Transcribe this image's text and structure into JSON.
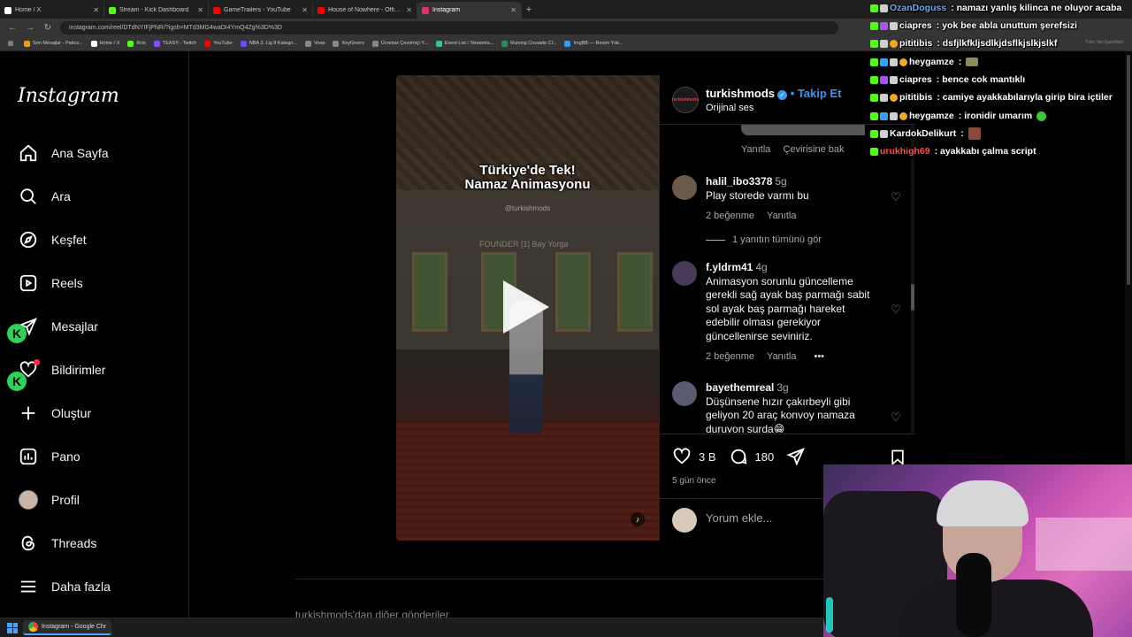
{
  "browser": {
    "tabs": [
      {
        "label": "Home / X",
        "favicon": "X",
        "color": "#ffffff"
      },
      {
        "label": "Stream - Kick Dashboard",
        "favicon": "K",
        "color": "#53fc18"
      },
      {
        "label": "GameTrailers - YouTube",
        "favicon": "▶",
        "color": "#ff0000"
      },
      {
        "label": "House of Nowhere - Official R",
        "favicon": "▶",
        "color": "#ff0000"
      },
      {
        "label": "Instagram",
        "favicon": "◎",
        "color": "#e1306c"
      }
    ],
    "new_tab": "+",
    "url": "instagram.com/reel/DTdNYIFjPNR/?igsh=MTd3MG4waDI4YmQ4Zg%3D%3D",
    "bookmarks": [
      {
        "label": "Son Mesajlar - Patics...",
        "color": "#f39c12"
      },
      {
        "label": "Home / X",
        "color": "#ffffff"
      },
      {
        "label": "Kick",
        "color": "#53fc18"
      },
      {
        "label": "TEASY - Twitch",
        "color": "#9146ff"
      },
      {
        "label": "YouTube",
        "color": "#ff0000"
      },
      {
        "label": "NBA 3. Lig 8 Katego...",
        "color": "#6a4cff"
      },
      {
        "label": "Voep",
        "color": "#888888"
      },
      {
        "label": "KeyGivers",
        "color": "#888888"
      },
      {
        "label": "Ücretsiz Çevrimiçi Y...",
        "color": "#888888"
      },
      {
        "label": "Event List / Streamla...",
        "color": "#31c3a2"
      },
      {
        "label": "Ruining Crusade Cl...",
        "color": "#2e8b57"
      },
      {
        "label": "ImgBB — Resim Yük...",
        "color": "#2a9df4"
      }
    ],
    "bookmarks_right": "Tüm Yer İşaretleri"
  },
  "instagram": {
    "logo": "Instagram",
    "nav": [
      {
        "label": "Ana Sayfa",
        "icon": "home-icon"
      },
      {
        "label": "Ara",
        "icon": "search-icon"
      },
      {
        "label": "Keşfet",
        "icon": "explore-icon"
      },
      {
        "label": "Reels",
        "icon": "reels-icon"
      },
      {
        "label": "Mesajlar",
        "icon": "messages-icon"
      },
      {
        "label": "Bildirimler",
        "icon": "notifications-icon"
      },
      {
        "label": "Oluştur",
        "icon": "create-icon"
      },
      {
        "label": "Pano",
        "icon": "dashboard-icon"
      },
      {
        "label": "Profil",
        "icon": "profile-icon"
      },
      {
        "label": "Threads",
        "icon": "threads-icon"
      },
      {
        "label": "Daha fazla",
        "icon": "menu-icon"
      }
    ],
    "video": {
      "title_line1": "Türkiye'de Tek!",
      "title_line2": "Namaz Animasyonu",
      "handle": "@turkishmods",
      "founder_tag": "FOUNDER [1] Bay Yorga"
    },
    "post": {
      "username": "turkishmods",
      "separator": "•",
      "follow": "Takip Et",
      "audio": "Orijinal ses",
      "avatar_text": "turkishmods",
      "prev_reply": "Yanıtla",
      "prev_translate": "Çevirisine bak",
      "comments": [
        {
          "user": "halil_ibo3378",
          "time": "5g",
          "text": "Play storede varmı bu",
          "likes": "2 beğenme",
          "reply": "Yanıtla",
          "avatar_color": "#6b5a4a"
        },
        {
          "user": "f.yldrm41",
          "time": "4g",
          "text": "Animasyon sorunlu güncelleme gerekli sağ ayak baş parmağı sabit sol ayak baş parmağı hareket edebilir olması gerekiyor güncellenirse seviniriz.",
          "likes": "2 beğenme",
          "reply": "Yanıtla",
          "more": "•••",
          "avatar_color": "#4a3a5a"
        },
        {
          "user": "bayethemreal",
          "time": "3g",
          "text": "Düşünsene hızır çakırbeyli gibi geliyon 20 araç konvoy namaza duruyon surda😁",
          "avatar_color": "#5a5a70"
        }
      ],
      "view_replies": "1 yanıtın tümünü gör",
      "likes": "3 B",
      "comment_count": "180",
      "posted": "5 gün önce",
      "add_comment_placeholder": "Yorum ekle..."
    },
    "bottom_text": "turkishmods'dan diğer gönderiler"
  },
  "chat": [
    {
      "user": "OzanDoguss",
      "user_color": "#6ea8ff",
      "msg": ": namazı yanlış kilinca ne oluyor acaba",
      "badges": [
        "#53fc18",
        "#cfcfcf"
      ]
    },
    {
      "user": "ciapres",
      "user_color": "#ffffff",
      "msg": ": yok bee abla unuttum şerefsizi",
      "badges": [
        "#53fc18",
        "#a855f7",
        "#cfcfcf"
      ]
    },
    {
      "user": "pititibis",
      "user_color": "#ffffff",
      "msg": ": dsfjlkfkljsdlkjdsflkjslkjslkf",
      "badges": [
        "#53fc18",
        "#cfcfcf",
        "#f5a623"
      ]
    },
    {
      "user": "heygamze",
      "user_color": "#ffffff",
      "msg": ":",
      "badges": [
        "#53fc18",
        "#3aa0ff",
        "#cfcfcf",
        "#f5a623"
      ],
      "emote": "#8a8a5a"
    },
    {
      "user": "ciapres",
      "user_color": "#ffffff",
      "msg": ": bence cok mantıklı",
      "badges": [
        "#53fc18",
        "#a855f7",
        "#cfcfcf"
      ]
    },
    {
      "user": "pititibis",
      "user_color": "#ffffff",
      "msg": ": camiye ayakkabılarıyla girip bira içtiler",
      "badges": [
        "#53fc18",
        "#cfcfcf",
        "#f5a623"
      ]
    },
    {
      "user": "heygamze",
      "user_color": "#ffffff",
      "msg": ": ironidir umarım",
      "badges": [
        "#53fc18",
        "#3aa0ff",
        "#cfcfcf",
        "#f5a623"
      ],
      "emote": "#39c93a"
    },
    {
      "user": "KardokDelikurt",
      "user_color": "#ffffff",
      "msg": ":",
      "badges": [
        "#53fc18",
        "#cfcfcf"
      ],
      "emote": "#8a4a3a"
    },
    {
      "user": "urukhigh69",
      "user_color": "#ff4d4d",
      "msg": ": ayakkabı çalma script",
      "badges": [
        "#53fc18"
      ]
    }
  ],
  "taskbar": {
    "app_label": "Instagram - Google Chr"
  }
}
